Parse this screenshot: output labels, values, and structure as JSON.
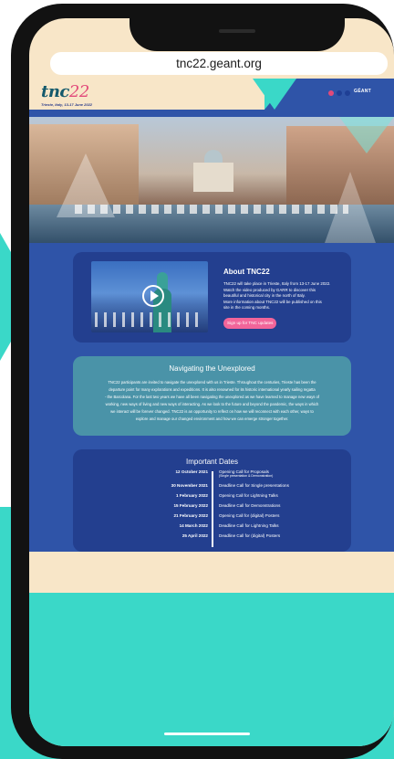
{
  "browser": {
    "url": "tnc22.geant.org"
  },
  "header": {
    "logo_text": "tnc",
    "logo_number": "22",
    "logo_subtitle": "Trieste, Italy, 13-17 June 2022",
    "geant_logo": "GÉANT",
    "dot_colors": [
      "#e2497a",
      "#1f3f95",
      "#1f3f95"
    ]
  },
  "about": {
    "title": "About TNC22",
    "lines": [
      "TNC22 will take place in Trieste, Italy from 13-17 June 2022.",
      "Watch the video produced by GARR to discover this",
      "beautiful and historical city in the north of Italy.",
      "More information about TNC22 will be published on this",
      "site in the coming months."
    ],
    "button": "Sign up for TNC updates",
    "video_icon": "play-icon"
  },
  "navigating": {
    "title": "Navigating the Unexplored",
    "lines": [
      "TNC22 participants are invited to navigate the unexplored with us in Trieste. Throughout the centuries, Trieste has been the",
      "departure point for many explorations and expeditions. It is also renowned for its historic international yearly sailing regatta",
      "- the Barcolana. For the last two years we have all been navigating the unexplored as we have learned to manage new ways of",
      "working, new ways of living and new ways of interacting. As we look to the future and beyond the pandemic, the ways in which",
      "we interact will be forever changed. TNC22 is an opportunity to reflect on how we will reconnect with each other, ways to",
      "explore and manage our changed environment and how we can emerge stronger together."
    ]
  },
  "dates": {
    "title": "Important Dates",
    "rows": [
      {
        "date": "12 October 2021",
        "event": "Opening Call for Proposals",
        "note": "(Single presentation & Demonstration)"
      },
      {
        "date": "30 November 2021",
        "event": "Deadline Call for Single presentations",
        "note": ""
      },
      {
        "date": "1 February 2022",
        "event": "Opening Call for Lightning Talks",
        "note": ""
      },
      {
        "date": "15 February 2022",
        "event": "Deadline Call for Demonstrations",
        "note": ""
      },
      {
        "date": "21 February 2022",
        "event": "Opening Call for (digital) Posters",
        "note": ""
      },
      {
        "date": "14 March 2022",
        "event": "Deadline Call for Lightning Talks",
        "note": ""
      },
      {
        "date": "25 April 2022",
        "event": "Deadline Call for (digital) Posters",
        "note": ""
      }
    ]
  },
  "colors": {
    "brand_blue": "#2f54a8",
    "dark_blue": "#233f8f",
    "teal": "#3ad8c8",
    "pink": "#f2659a",
    "beige": "#f8e6c8"
  }
}
